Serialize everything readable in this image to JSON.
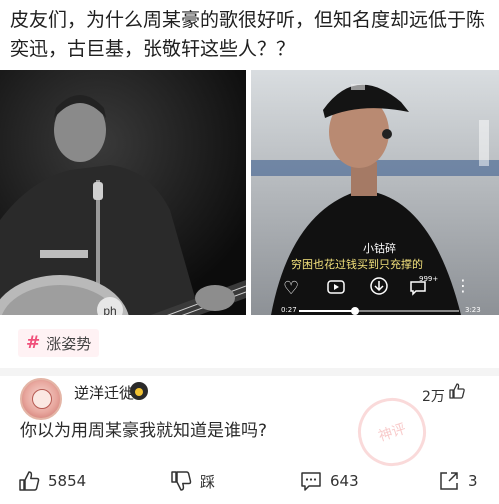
{
  "post": {
    "title": "皮友们，为什么周某豪的歌很好听，但知名度却远低于陈奕迅，古巨基，张敬轩这些人？？"
  },
  "video": {
    "subtitle_name": "小钴碎",
    "subtitle_line": "穷困也花过钱买到只充撑的",
    "badge_count": "999+",
    "time_left": "0:27",
    "time_right": "3:23"
  },
  "topic_tag": {
    "label": "涨姿势"
  },
  "comment": {
    "username": "逆洋迁徙",
    "text": "你以为用周某豪我就知道是谁吗?",
    "like_count": "2万",
    "watermark": "神评"
  },
  "actions": {
    "like_count": "5854",
    "dislike_label": "踩",
    "comment_count": "643",
    "share_count": "3"
  },
  "colors": {
    "tag_hash": "#f0507a",
    "tag_bg": "#fff2f4",
    "subtitle_yellow": "#f4e27c"
  }
}
